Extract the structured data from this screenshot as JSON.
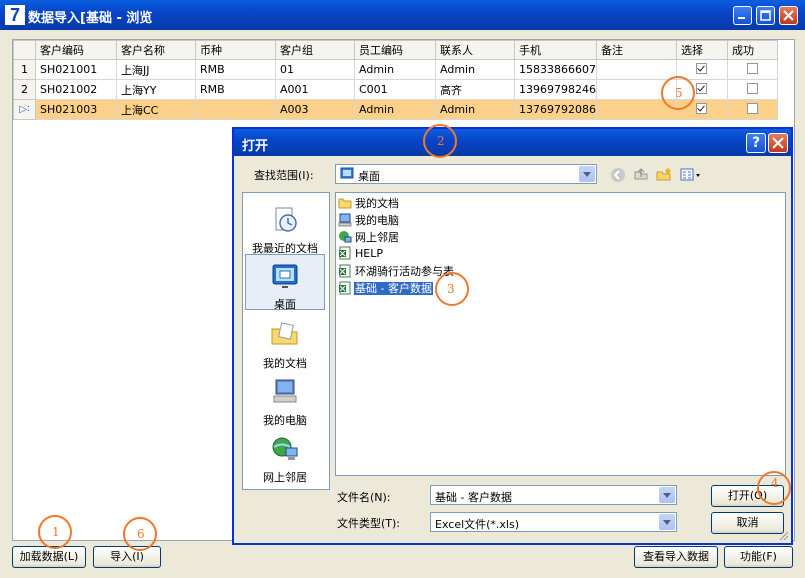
{
  "main_window": {
    "title": "数据导入[基础 - 浏览",
    "app_icon_glyph": "7",
    "controls": {
      "minimize": "minimize-icon",
      "maximize": "maximize-icon",
      "close": "close-icon"
    }
  },
  "grid": {
    "columns": [
      "客户编码",
      "客户名称",
      "币种",
      "客户组",
      "员工编码",
      "联系人",
      "手机",
      "备注",
      "选择",
      "成功"
    ],
    "rows": [
      {
        "hdr": "1",
        "code": "SH021001",
        "name": "上海JJ",
        "currency": "RMB",
        "group": "01",
        "emp": "Admin",
        "contact": "Admin",
        "phone": "15833866607",
        "note": "",
        "select": true,
        "success": false
      },
      {
        "hdr": "2",
        "code": "SH021002",
        "name": "上海YY",
        "currency": "RMB",
        "group": "A001",
        "emp": "C001",
        "contact": "高齐",
        "phone": "13969798246",
        "note": "",
        "select": true,
        "success": false
      },
      {
        "hdr": "▷∶",
        "code": "SH021003",
        "name": "上海CC",
        "currency": "",
        "group": "A003",
        "emp": "Admin",
        "contact": "Admin",
        "phone": "13769792086",
        "note": "",
        "select": true,
        "success": false
      }
    ],
    "selected_row_color": "#fbd089"
  },
  "bottom_buttons": {
    "load": "加载数据(L)",
    "import": "导入(I)",
    "view_result": "查看导入数据",
    "function": "功能(F)"
  },
  "dialog": {
    "title": "打开",
    "help": "?",
    "look_in_label": "查找范围(I):",
    "look_in_value": "桌面",
    "places": [
      "我最近的文档",
      "桌面",
      "我的文档",
      "我的电脑",
      "网上邻居"
    ],
    "files": [
      {
        "name": "我的文档",
        "icon": "folder-icon"
      },
      {
        "name": "我的电脑",
        "icon": "computer-icon"
      },
      {
        "name": "网上邻居",
        "icon": "network-icon"
      },
      {
        "name": "HELP",
        "icon": "excel-file-icon"
      },
      {
        "name": "环湖骑行活动参与表",
        "icon": "excel-file-icon"
      },
      {
        "name": "基础 - 客户数据",
        "icon": "excel-file-icon",
        "selected": true
      }
    ],
    "filename_label": "文件名(N):",
    "filename_value": "基础 - 客户数据",
    "filetype_label": "文件类型(T):",
    "filetype_value": "Excel文件(*.xls)",
    "open_button": "打开(O)",
    "cancel_button": "取消"
  },
  "annotations": [
    "1",
    "2",
    "3",
    "4",
    "5",
    "6"
  ],
  "accent_color": "#f0782a"
}
